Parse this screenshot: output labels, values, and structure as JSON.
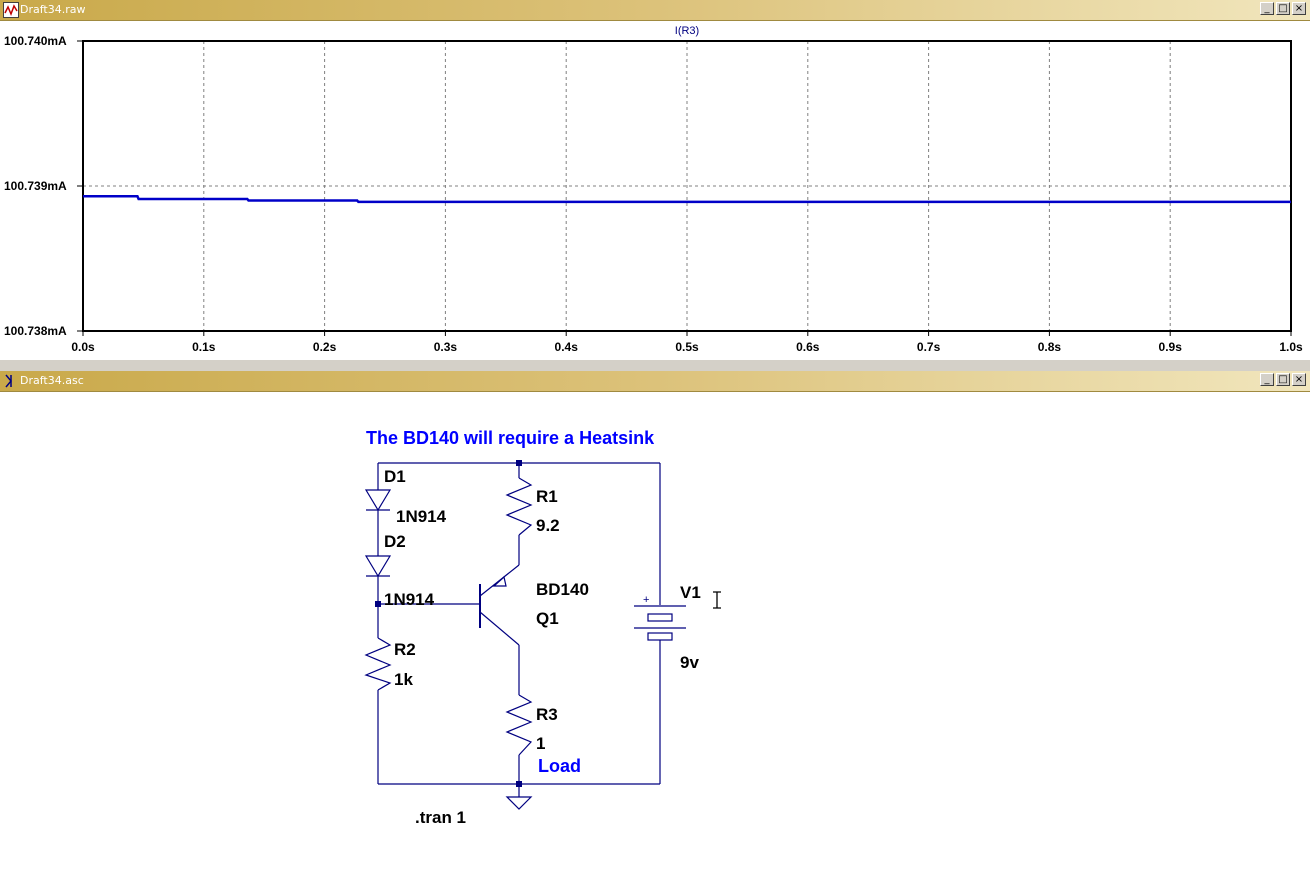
{
  "plot_window": {
    "title": "Draft34.raw",
    "trace_label": "I(R3)",
    "buttons": {
      "minimize": "_",
      "maximize": "□",
      "close": "×"
    }
  },
  "chart_data": {
    "type": "line",
    "title": "I(R3)",
    "xlabel": "",
    "ylabel": "",
    "xlim": [
      0,
      1
    ],
    "ylim": [
      100.738,
      100.74
    ],
    "x_ticks": [
      "0.0s",
      "0.1s",
      "0.2s",
      "0.3s",
      "0.4s",
      "0.5s",
      "0.6s",
      "0.7s",
      "0.8s",
      "0.9s",
      "1.0s"
    ],
    "y_ticks": [
      "100.740mA",
      "100.739mA",
      "100.738mA"
    ],
    "grid": true,
    "series": [
      {
        "name": "I(R3)",
        "color": "#0000c8",
        "x": [
          0,
          0.045,
          0.046,
          0.136,
          0.137,
          0.227,
          0.228,
          1.0
        ],
        "y": [
          100.73893,
          100.73893,
          100.73891,
          100.73891,
          100.7389,
          100.7389,
          100.73889,
          100.73889
        ]
      }
    ]
  },
  "schematic_window": {
    "title": "Draft34.asc",
    "buttons": {
      "minimize": "_",
      "maximize": "□",
      "close": "×"
    }
  },
  "schematic": {
    "comment": "The BD140 will require a Heatsink",
    "load_label": "Load",
    "directive": ".tran 1",
    "d1": {
      "name": "D1",
      "value": "1N914"
    },
    "d2": {
      "name": "D2",
      "value": "1N914"
    },
    "r1": {
      "name": "R1",
      "value": "9.2"
    },
    "r2": {
      "name": "R2",
      "value": "1k"
    },
    "r3": {
      "name": "R3",
      "value": "1"
    },
    "q1": {
      "name": "Q1",
      "value": "BD140"
    },
    "v1": {
      "name": "V1",
      "value": "9v",
      "plus": "+"
    },
    "colors": {
      "wire": "#000080",
      "comment": "#0000ff",
      "label": "#000000"
    }
  }
}
